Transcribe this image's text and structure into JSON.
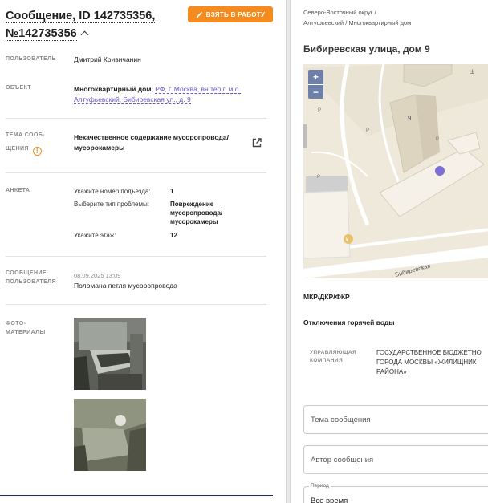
{
  "header": {
    "title_line1": "Сообщение, ID 142735356,",
    "title_line2": "№142735356",
    "take_button": "ВЗЯТЬ В РАБОТУ"
  },
  "details": {
    "user": {
      "label": "ПОЛЬЗОВАТЕЛЬ",
      "value": "Дмитрий Кривичанин"
    },
    "object": {
      "label": "ОБЪЕКТ",
      "value_prefix": "Многоквартирный дом, ",
      "value_link_line1": "РФ, г. Москва, вн.тер.г. м.о.",
      "value_link_line2": "Алтуфьевский, Бибиревская ул., д. 9"
    },
    "topic": {
      "label_line1": "ТЕМА СООБ-",
      "label_line2": "ЩЕНИЯ",
      "warning": "!",
      "value_line1": "Некачественное содержание мусоропровода/",
      "value_line2": "мусорокамеры"
    },
    "form": {
      "label": "АНКЕТА",
      "q1": "Укажите номер подъезда:",
      "a1": "1",
      "q2": "Выберите тип проблемы:",
      "a2_line1": "Повреждение",
      "a2_line2": "мусоропровода/",
      "a2_line3": "мусорокамеры",
      "q3": "Укажите этаж:",
      "a3": "12"
    },
    "message": {
      "label_line1": "СООБЩЕНИЕ",
      "label_line2": "ПОЛЬЗОВАТЕЛЯ",
      "date": "08.09.2025 13:09",
      "text": "Поломана петля мусоропровода"
    },
    "photos": {
      "label_line1": "ФОТО-",
      "label_line2": "МАТЕРИАЛЫ"
    }
  },
  "right": {
    "breadcrumb_line1": "Северо-Восточный округ /",
    "breadcrumb_line2": "Алтуфьевский / Многоквартирный дом",
    "address": "Бибиревская улица, дом 9",
    "map": {
      "zoom_in": "+",
      "zoom_out": "−",
      "street": "Бибиревская",
      "building_number": "9"
    },
    "mkr": "МКР/ДКР/ФКР",
    "hot_water": "Отключения горячей воды",
    "org_label_line1": "УПРАВЛЯЮЩАЯ",
    "org_label_line2": "КОМПАНИЯ",
    "org_line1": "ГОСУДАРСТВЕННОЕ БЮДЖЕТНО",
    "org_line2": "ГОРОДА МОСКВЫ «ЖИЛИЩНИК",
    "org_line3": "РАЙОНА»",
    "topic_placeholder": "Тема сообщения",
    "author_placeholder": "Автор сообщения",
    "period_legend": "Период",
    "period_value": "Все время"
  },
  "colors": {
    "accent": "#f58a1f",
    "link": "#6b57c9",
    "map_marker": "#7b6fd6"
  }
}
